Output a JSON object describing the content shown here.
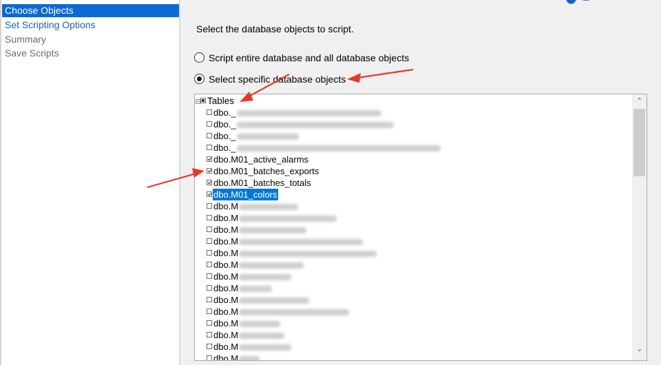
{
  "nav": {
    "items": [
      {
        "label": "Choose Objects",
        "state": "selected"
      },
      {
        "label": "Set Scripting Options",
        "state": "link"
      },
      {
        "label": "Summary",
        "state": "disabled"
      },
      {
        "label": "Save Scripts",
        "state": "disabled"
      }
    ]
  },
  "main": {
    "instruction": "Select the database objects to script.",
    "options": [
      {
        "label": "Script entire database and all database objects",
        "selected": false
      },
      {
        "label": "Select specific database objects",
        "selected": true
      }
    ],
    "tree": {
      "root_label": "Tables",
      "root_state": "partial",
      "items": [
        {
          "label": "dbo._",
          "checked": false,
          "redacted": true
        },
        {
          "label": "dbo._",
          "checked": false,
          "redacted": true
        },
        {
          "label": "dbo._",
          "checked": false,
          "redacted": true
        },
        {
          "label": "dbo._",
          "checked": false,
          "redacted": true
        },
        {
          "label": "dbo.M01_active_alarms",
          "checked": true,
          "redacted": false
        },
        {
          "label": "dbo.M01_batches_exports",
          "checked": true,
          "redacted": false
        },
        {
          "label": "dbo.M01_batches_totals",
          "checked": true,
          "redacted": false
        },
        {
          "label": "dbo.M01_colors",
          "checked": true,
          "redacted": false,
          "selected": true
        },
        {
          "label": "dbo.M",
          "checked": false,
          "redacted": true
        },
        {
          "label": "dbo.M",
          "checked": false,
          "redacted": true
        },
        {
          "label": "dbo.M",
          "checked": false,
          "redacted": true
        },
        {
          "label": "dbo.M",
          "checked": false,
          "redacted": true
        },
        {
          "label": "dbo.M",
          "checked": false,
          "redacted": true
        },
        {
          "label": "dbo.M",
          "checked": false,
          "redacted": true
        },
        {
          "label": "dbo.M",
          "checked": false,
          "redacted": true
        },
        {
          "label": "dbo.M",
          "checked": false,
          "redacted": true
        },
        {
          "label": "dbo.M",
          "checked": false,
          "redacted": true
        },
        {
          "label": "dbo.M",
          "checked": false,
          "redacted": true
        },
        {
          "label": "dbo.M",
          "checked": false,
          "redacted": true
        },
        {
          "label": "dbo.M",
          "checked": false,
          "redacted": true
        },
        {
          "label": "dbo.M",
          "checked": false,
          "redacted": true
        },
        {
          "label": "dbo.M",
          "checked": false,
          "redacted": true
        }
      ]
    }
  },
  "colors": {
    "selection": "#0a6ad3",
    "tree_selection": "#0078d7",
    "link": "#1a5fb4",
    "annotation_arrow": "#e8372a"
  },
  "icons": {
    "help": "info-circle-icon",
    "scroll_up": "chevron-up-icon",
    "scroll_down": "chevron-down-icon",
    "expander": "collapse-minus-icon"
  }
}
